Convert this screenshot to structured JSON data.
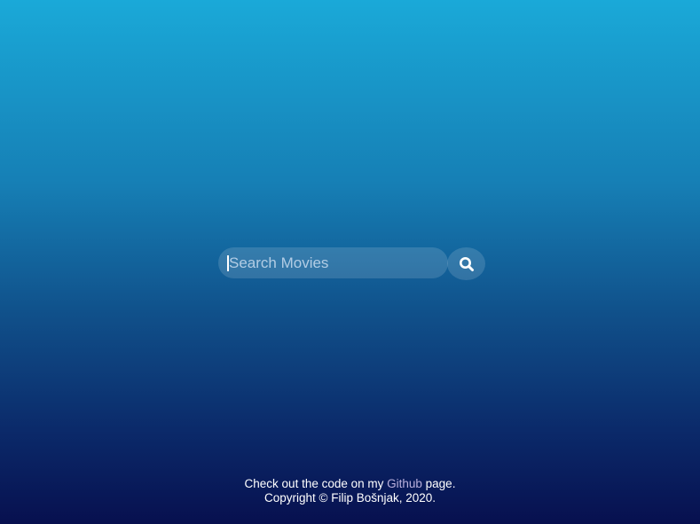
{
  "search": {
    "placeholder": "Search Movies",
    "value": "",
    "button_icon": "search-icon"
  },
  "footer": {
    "line1_prefix": "Check out the code on my ",
    "link_label": "Github",
    "line1_suffix": " page.",
    "copyright": "Copyright © Filip Bošnjak, 2020."
  },
  "colors": {
    "background_top": "#1aa9d8",
    "background_bottom": "#07104f",
    "link": "#b9b0dc"
  }
}
